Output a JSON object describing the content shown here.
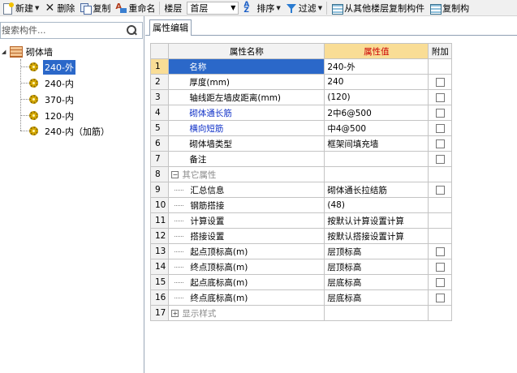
{
  "toolbar": {
    "new_label": "新建",
    "delete_label": "删除",
    "copy_label": "复制",
    "rename_label": "重命名",
    "floor_label": "楼层",
    "floor_value": "首层",
    "sort_label": "排序",
    "filter_label": "过滤",
    "copy_from_floor_label": "从其他楼层复制构件",
    "copy_to_floor_label": "复制构"
  },
  "left_panel": {
    "search_placeholder": "搜索构件...",
    "tree": {
      "root_label": "砌体墙",
      "items": [
        {
          "label": "240-外",
          "selected": true
        },
        {
          "label": "240-内",
          "selected": false
        },
        {
          "label": "370-内",
          "selected": false
        },
        {
          "label": "120-内",
          "selected": false
        },
        {
          "label": "240-内（加筋）",
          "selected": false
        }
      ]
    }
  },
  "right_panel": {
    "tab_label": "属性编辑",
    "columns": {
      "name": "属性名称",
      "value": "属性值",
      "extra": "附加"
    },
    "rows": [
      {
        "num": "1",
        "name": "名称",
        "value": "240-外",
        "has_checkbox": false
      },
      {
        "num": "2",
        "name": "厚度(mm)",
        "value": "240",
        "has_checkbox": true
      },
      {
        "num": "3",
        "name": "轴线距左墙皮距离(mm)",
        "value": "(120)",
        "has_checkbox": true
      },
      {
        "num": "4",
        "name": "砌体通长筋",
        "value": "2中6@500",
        "has_checkbox": true
      },
      {
        "num": "5",
        "name": "横向短筋",
        "value": "中4@500",
        "has_checkbox": true
      },
      {
        "num": "6",
        "name": "砌体墙类型",
        "value": "框架间填充墙",
        "has_checkbox": true
      },
      {
        "num": "7",
        "name": "备注",
        "value": "",
        "has_checkbox": true
      },
      {
        "num": "8",
        "name": "其它属性",
        "value": "",
        "has_checkbox": false
      },
      {
        "num": "9",
        "name": "汇总信息",
        "value": "砌体通长拉结筋",
        "has_checkbox": true
      },
      {
        "num": "10",
        "name": "钢筋搭接",
        "value": "(48)",
        "has_checkbox": false
      },
      {
        "num": "11",
        "name": "计算设置",
        "value": "按默认计算设置计算",
        "has_checkbox": false
      },
      {
        "num": "12",
        "name": "搭接设置",
        "value": "按默认搭接设置计算",
        "has_checkbox": false
      },
      {
        "num": "13",
        "name": "起点顶标高(m)",
        "value": "层顶标高",
        "has_checkbox": true
      },
      {
        "num": "14",
        "name": "终点顶标高(m)",
        "value": "层顶标高",
        "has_checkbox": true
      },
      {
        "num": "15",
        "name": "起点底标高(m)",
        "value": "层底标高",
        "has_checkbox": true
      },
      {
        "num": "16",
        "name": "终点底标高(m)",
        "value": "层底标高",
        "has_checkbox": true
      },
      {
        "num": "17",
        "name": "显示样式",
        "value": "",
        "has_checkbox": false
      }
    ]
  },
  "colors": {
    "selection": "#2b68c9",
    "header_highlight": "#f9dd96",
    "header_text_red": "#cc0000",
    "blue_property": "#1233c8"
  }
}
